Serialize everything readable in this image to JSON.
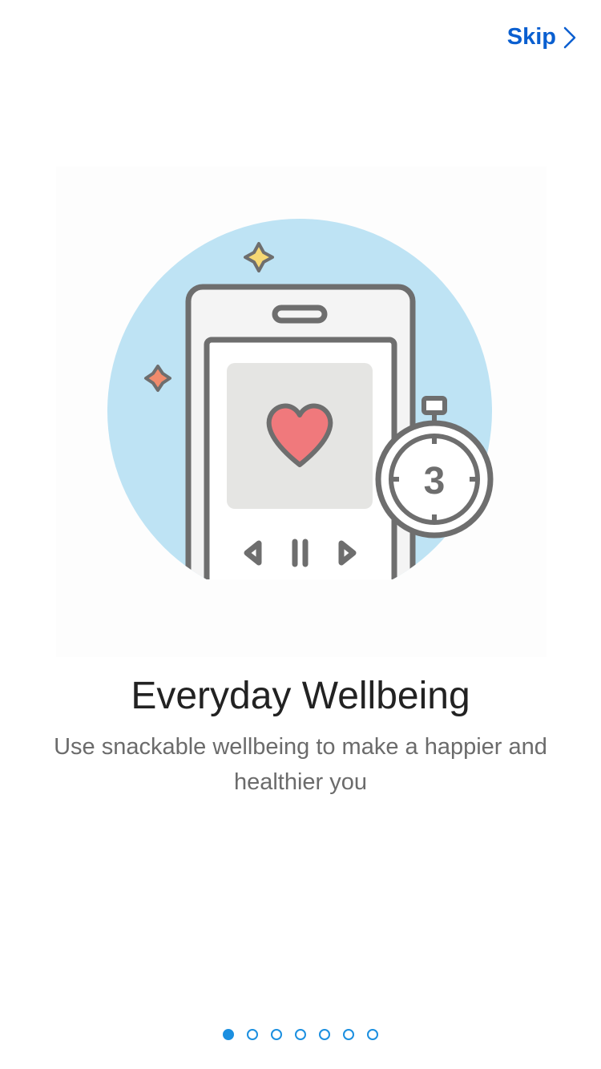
{
  "header": {
    "skip_label": "Skip",
    "skip_icon": "chevron-right-icon",
    "accent_color": "#0a5fd0"
  },
  "illustration": {
    "timer_number": "3",
    "circle_color": "#bee3f4",
    "heart_color": "#f0797c",
    "icons": [
      "phone-icon",
      "heart-icon",
      "stopwatch-icon",
      "sparkle-icon",
      "play-controls-icon"
    ]
  },
  "content": {
    "title": "Everyday Wellbeing",
    "subtitle": "Use snackable wellbeing to make a happier and healthier you"
  },
  "pager": {
    "total": 7,
    "current_page": 1,
    "active_color": "#1b8fe0"
  }
}
